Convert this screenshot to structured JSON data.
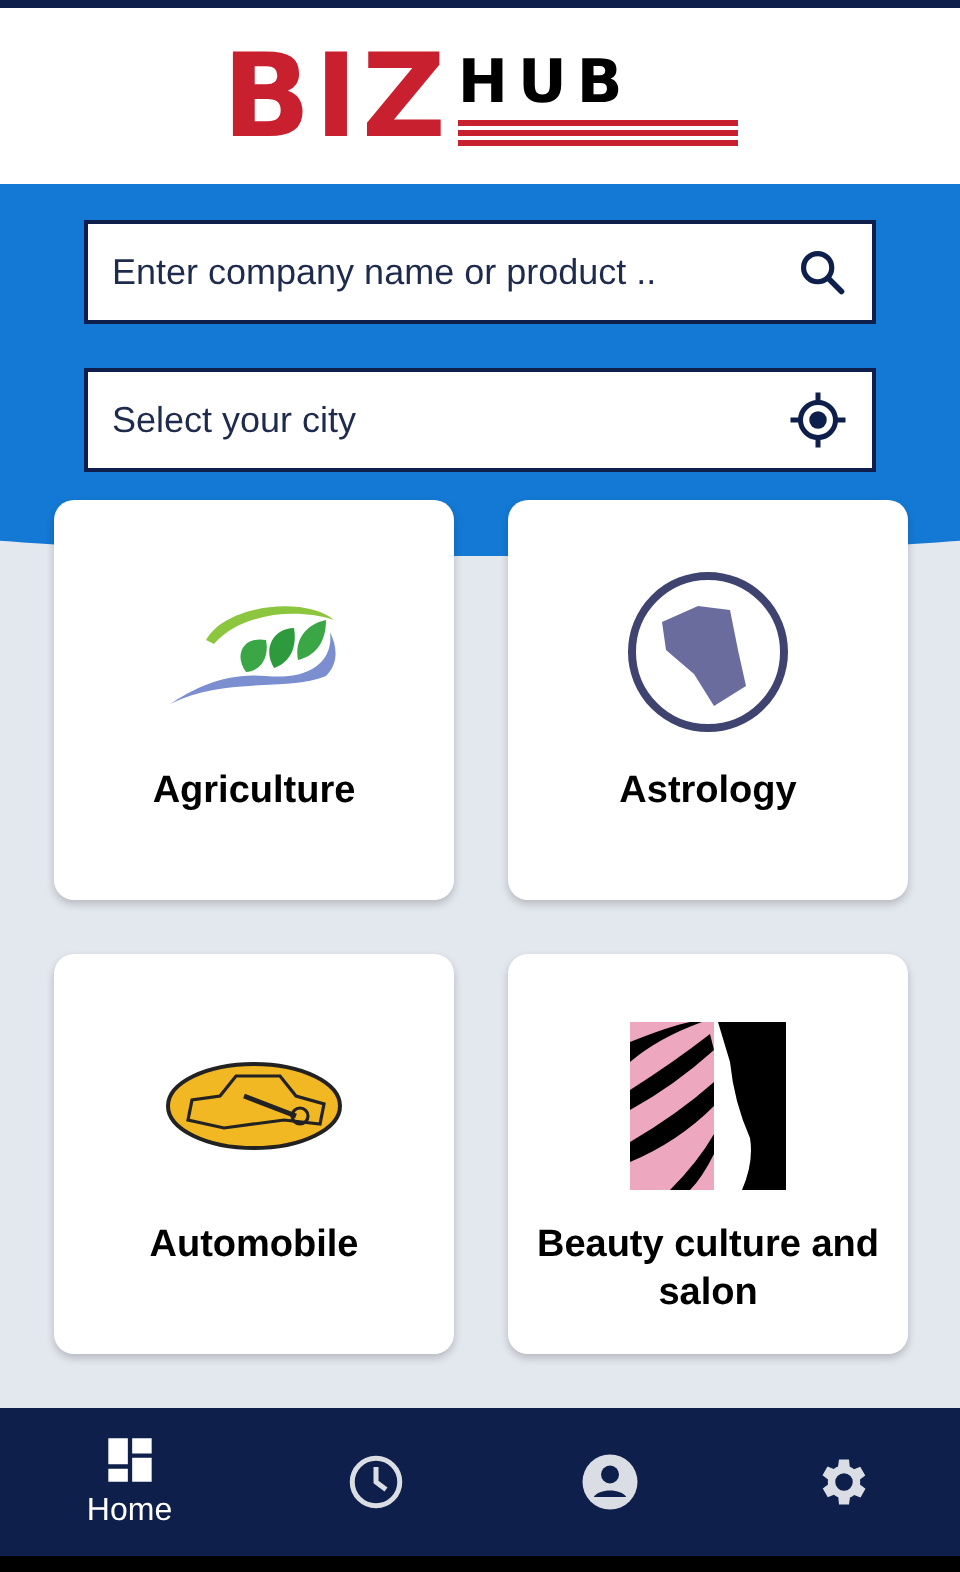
{
  "logo": {
    "primary": "BIZ",
    "secondary": "HUB"
  },
  "search": {
    "placeholder": "Enter company name or product .."
  },
  "city": {
    "placeholder": "Select your city"
  },
  "categories": [
    {
      "kind": "agriculture",
      "label": "Agriculture"
    },
    {
      "kind": "astrology",
      "label": "Astrology"
    },
    {
      "kind": "automobile",
      "label": "Automobile"
    },
    {
      "kind": "beauty",
      "label": "Beauty culture and salon"
    }
  ],
  "nav": [
    {
      "kind": "home",
      "label": "Home",
      "selected": true
    },
    {
      "kind": "history",
      "selected": false
    },
    {
      "kind": "profile",
      "selected": false
    },
    {
      "kind": "settings",
      "selected": false
    }
  ]
}
